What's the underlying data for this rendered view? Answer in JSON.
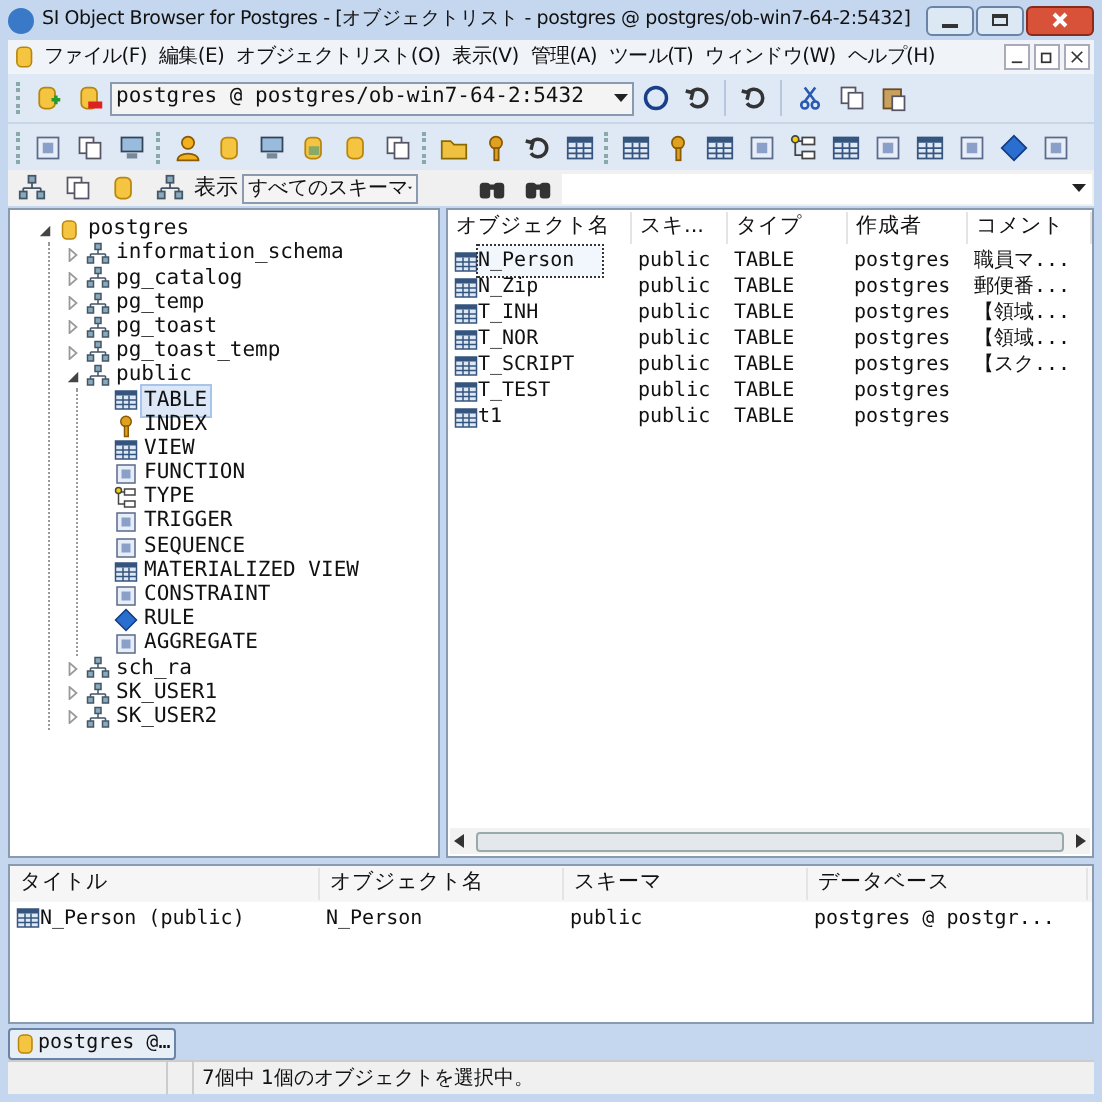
{
  "window": {
    "title": "SI Object Browser for Postgres - [オブジェクトリスト - postgres @ postgres/ob-win7-64-2:5432]"
  },
  "menu": [
    "ファイル(F)",
    "編集(E)",
    "オブジェクトリスト(O)",
    "表示(V)",
    "管理(A)",
    "ツール(T)",
    "ウィンドウ(W)",
    "ヘルプ(H)"
  ],
  "connection_combo": {
    "value": "postgres @ postgres/ob-win7-64-2:5432"
  },
  "filter": {
    "label": "表示",
    "schema_select": "すべてのスキーマ"
  },
  "tree": [
    {
      "label": "postgres",
      "kind": "database",
      "expanded": true,
      "selected": false,
      "children": [
        {
          "label": "information_schema",
          "kind": "schema",
          "expanded": false,
          "selected": false
        },
        {
          "label": "pg_catalog",
          "kind": "schema",
          "expanded": false,
          "selected": false
        },
        {
          "label": "pg_temp",
          "kind": "schema",
          "expanded": false,
          "selected": false
        },
        {
          "label": "pg_toast",
          "kind": "schema",
          "expanded": false,
          "selected": false
        },
        {
          "label": "pg_toast_temp",
          "kind": "schema",
          "expanded": false,
          "selected": false
        },
        {
          "label": "public",
          "kind": "schema",
          "expanded": true,
          "selected": false,
          "children": [
            {
              "label": "TABLE",
              "kind": "table",
              "selected": true
            },
            {
              "label": "INDEX",
              "kind": "index",
              "selected": false
            },
            {
              "label": "VIEW",
              "kind": "view",
              "selected": false
            },
            {
              "label": "FUNCTION",
              "kind": "function",
              "selected": false
            },
            {
              "label": "TYPE",
              "kind": "type",
              "selected": false
            },
            {
              "label": "TRIGGER",
              "kind": "trigger",
              "selected": false
            },
            {
              "label": "SEQUENCE",
              "kind": "sequence",
              "selected": false
            },
            {
              "label": "MATERIALIZED VIEW",
              "kind": "view",
              "selected": false
            },
            {
              "label": "CONSTRAINT",
              "kind": "constraint",
              "selected": false
            },
            {
              "label": "RULE",
              "kind": "rule",
              "selected": false
            },
            {
              "label": "AGGREGATE",
              "kind": "aggregate",
              "selected": false
            }
          ]
        },
        {
          "label": "sch_ra",
          "kind": "schema",
          "expanded": false,
          "selected": false
        },
        {
          "label": "SK_USER1",
          "kind": "schema",
          "expanded": false,
          "selected": false
        },
        {
          "label": "SK_USER2",
          "kind": "schema",
          "expanded": false,
          "selected": false
        }
      ]
    }
  ],
  "object_list": {
    "columns": [
      "オブジェクト名",
      "スキ...",
      "タイプ",
      "作成者",
      "コメント"
    ],
    "rows": [
      {
        "cells": [
          "N_Person",
          "public",
          "TABLE",
          "postgres",
          "職員マ..."
        ],
        "selected": true
      },
      {
        "cells": [
          "N_Zip",
          "public",
          "TABLE",
          "postgres",
          "郵便番..."
        ],
        "selected": false
      },
      {
        "cells": [
          "T_INH",
          "public",
          "TABLE",
          "postgres",
          "【領域..."
        ],
        "selected": false
      },
      {
        "cells": [
          "T_NOR",
          "public",
          "TABLE",
          "postgres",
          "【領域..."
        ],
        "selected": false
      },
      {
        "cells": [
          "T_SCRIPT",
          "public",
          "TABLE",
          "postgres",
          "【スク..."
        ],
        "selected": false
      },
      {
        "cells": [
          "T_TEST",
          "public",
          "TABLE",
          "postgres",
          ""
        ],
        "selected": false
      },
      {
        "cells": [
          "t1",
          "public",
          "TABLE",
          "postgres",
          ""
        ],
        "selected": false
      }
    ]
  },
  "selection_panel": {
    "columns": [
      "タイトル",
      "オブジェクト名",
      "スキーマ",
      "データベース"
    ],
    "rows": [
      {
        "cells": [
          "N_Person (public)",
          "N_Person",
          "public",
          "postgres @ postgr..."
        ]
      }
    ]
  },
  "tabs": [
    {
      "label": "postgres @…",
      "selected": true
    }
  ],
  "status_bar": {
    "text": "7個中 1個のオブジェクトを選択中。"
  }
}
